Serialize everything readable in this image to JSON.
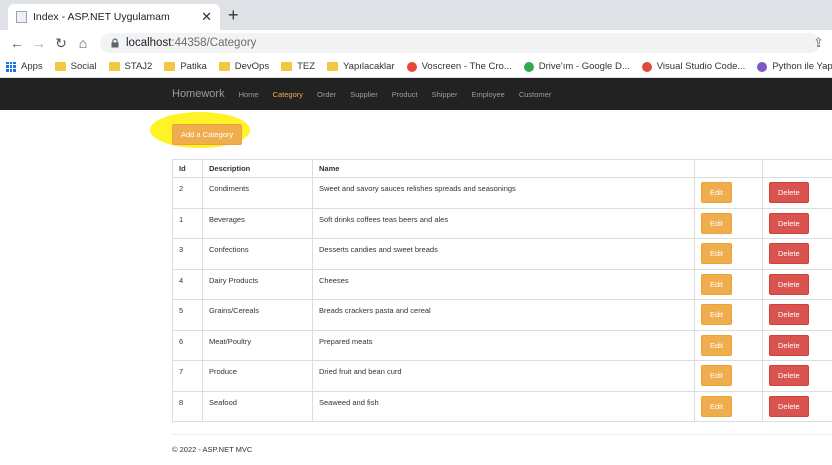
{
  "browser": {
    "tab_title": "Index - ASP.NET Uygulamam",
    "url_host": "localhost",
    "url_path": ":44358/Category",
    "bookmarks": [
      {
        "label": "Apps",
        "icon": "apps-grid-icon"
      },
      {
        "label": "Social",
        "icon": "folder-icon"
      },
      {
        "label": "STAJ2",
        "icon": "folder-icon"
      },
      {
        "label": "Patika",
        "icon": "folder-icon"
      },
      {
        "label": "DevOps",
        "icon": "folder-icon"
      },
      {
        "label": "TEZ",
        "icon": "folder-icon"
      },
      {
        "label": "Yapılacaklar",
        "icon": "folder-icon"
      },
      {
        "label": "Voscreen - The Cro...",
        "icon": "voscreen-icon",
        "color": "#e8453c"
      },
      {
        "label": "Drive'ım - Google D...",
        "icon": "google-drive-icon",
        "color": "#34a853"
      },
      {
        "label": "Visual Studio Code...",
        "icon": "visual-studio-icon",
        "color": "#e04a3a"
      },
      {
        "label": "Python ile Yapay Ze...",
        "icon": "python-course-icon",
        "color": "#7e57c2"
      }
    ]
  },
  "navbar": {
    "brand": "Homework",
    "links": [
      "Home",
      "Category",
      "Order",
      "Supplier",
      "Product",
      "Shipper",
      "Employee",
      "Customer"
    ],
    "active": "Category"
  },
  "main": {
    "add_button": "Add a Category",
    "table": {
      "headers": [
        "Id",
        "Description",
        "Name",
        "",
        ""
      ],
      "edit_label": "Edit",
      "delete_label": "Delete",
      "rows": [
        {
          "id": "2",
          "description": "Condiments",
          "name": "Sweet and savory sauces relishes spreads and seasonings"
        },
        {
          "id": "1",
          "description": "Beverages",
          "name": "Soft drinks coffees teas beers and ales"
        },
        {
          "id": "3",
          "description": "Confections",
          "name": "Desserts candies and sweet breads"
        },
        {
          "id": "4",
          "description": "Dairy Products",
          "name": "Cheeses"
        },
        {
          "id": "5",
          "description": "Grains/Cereals",
          "name": "Breads crackers pasta and cereal"
        },
        {
          "id": "6",
          "description": "Meat/Poultry",
          "name": "Prepared meats"
        },
        {
          "id": "7",
          "description": "Produce",
          "name": "Dried fruit and bean curd"
        },
        {
          "id": "8",
          "description": "Seafood",
          "name": "Seaweed and fish"
        }
      ]
    }
  },
  "footer": {
    "text": "© 2022 - ASP.NET MVC"
  },
  "colors": {
    "accent": "#f0ad4e",
    "danger": "#d9534f",
    "navbar": "#222222",
    "highlight": "#fff000"
  }
}
